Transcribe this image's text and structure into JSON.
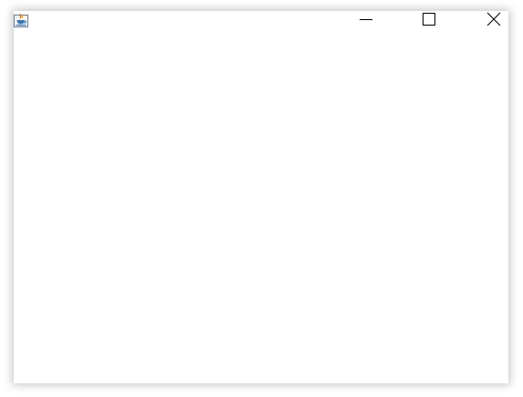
{
  "window": {
    "icon": "java-coffee-cup-icon",
    "controls": {
      "minimize_icon": "minimize-icon",
      "maximize_icon": "maximize-icon",
      "close_icon": "close-icon"
    }
  },
  "colors": {
    "window_background": "#ffffff",
    "icon_stroke": "#000000",
    "java_orange": "#e76f00",
    "java_blue": "#3a75b0"
  }
}
